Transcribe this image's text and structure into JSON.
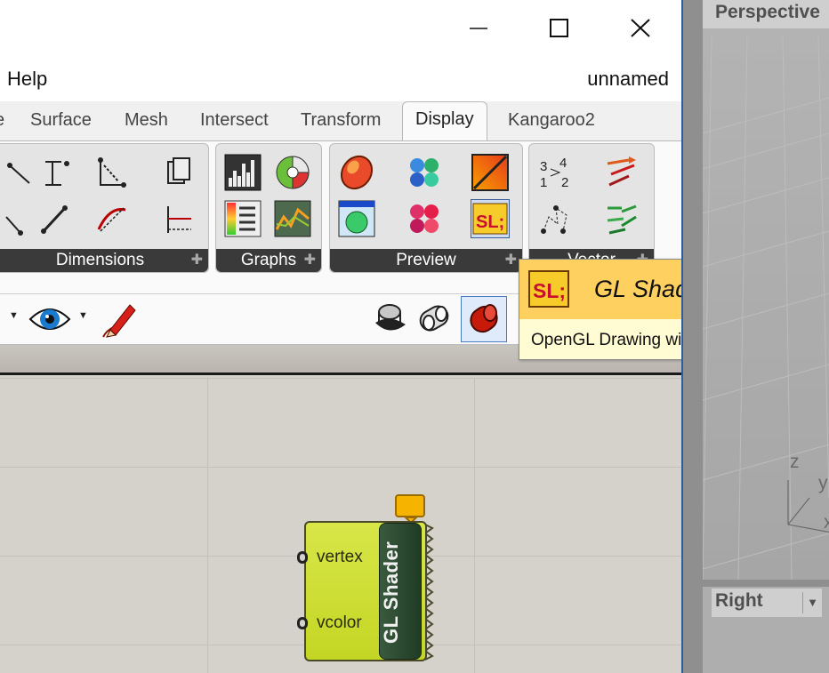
{
  "window": {
    "menu_help": "Help",
    "document_name": "unnamed",
    "controls": {
      "minimize": "minimize-icon",
      "maximize": "maximize-icon",
      "close": "close-icon"
    }
  },
  "tabs": [
    {
      "label": "e"
    },
    {
      "label": "Surface"
    },
    {
      "label": "Mesh"
    },
    {
      "label": "Intersect"
    },
    {
      "label": "Transform"
    },
    {
      "label": "Display",
      "active": true
    },
    {
      "label": "Kangaroo2"
    }
  ],
  "ribbon": {
    "panels": [
      {
        "label": "Dimensions"
      },
      {
        "label": "Graphs"
      },
      {
        "label": "Preview"
      },
      {
        "label": "Vector"
      }
    ]
  },
  "tooltip": {
    "title": "GL Shader",
    "description": "OpenGL Drawing with a shader",
    "icon_text": "SL;"
  },
  "component": {
    "name": "GL Shader",
    "inputs": [
      "vertex",
      "vcolor"
    ]
  },
  "viewports": {
    "top": "Perspective",
    "bottom": "Right",
    "axes": {
      "z": "z",
      "y": "y",
      "x": "x"
    }
  },
  "colors": {
    "accent_blue": "#2b5e9e",
    "tooltip_header": "#fdd060",
    "tooltip_body": "#fffbd3",
    "component_body": "#c4d624"
  }
}
